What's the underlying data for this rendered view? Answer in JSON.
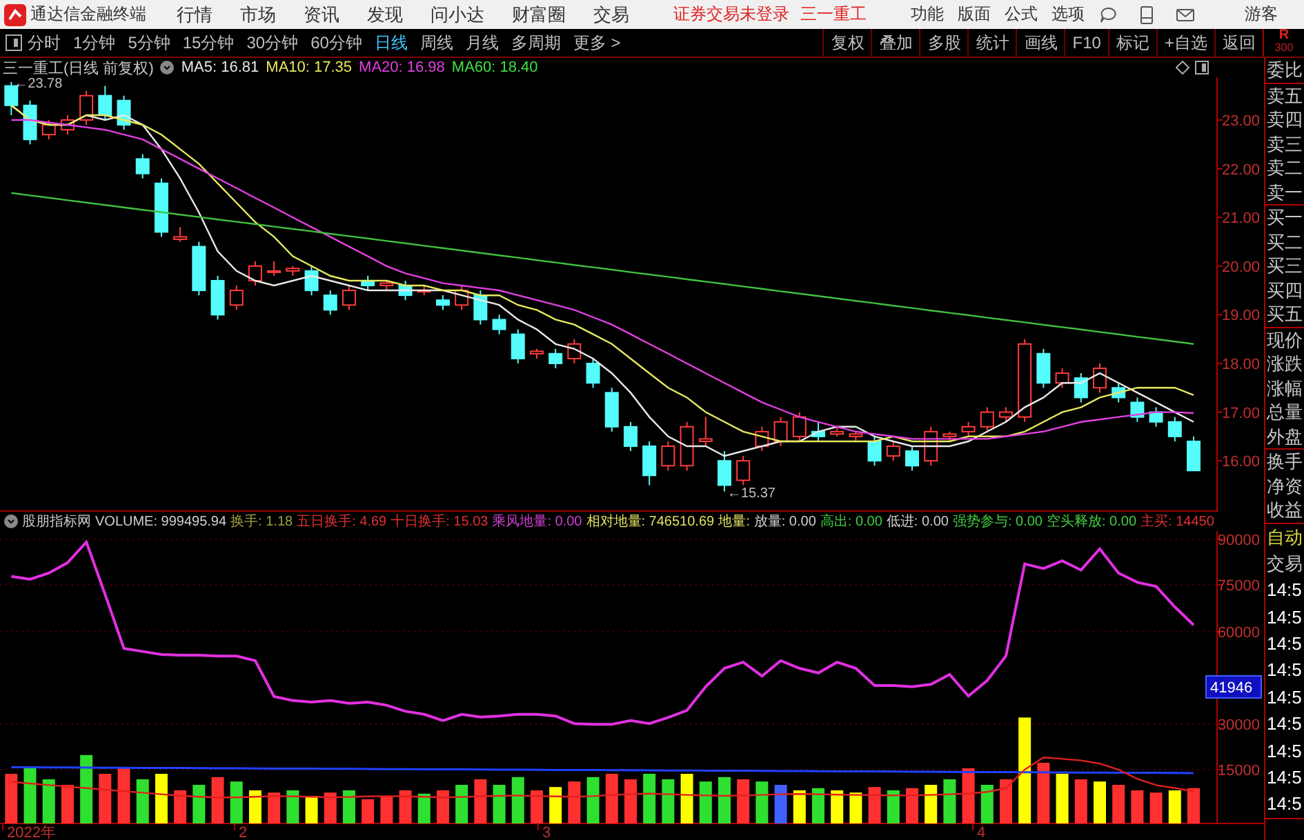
{
  "menu_bar": {
    "app_title": "通达信金融终端",
    "menus": [
      "行情",
      "市场",
      "资讯",
      "发现",
      "问小达",
      "财富圈",
      "交易"
    ],
    "notice": "证券交易未登录",
    "stock": "三一重工",
    "tools": [
      "功能",
      "版面",
      "公式",
      "选项"
    ],
    "user": "游客"
  },
  "toolbar": {
    "periods": [
      {
        "label": "分时",
        "selected": false
      },
      {
        "label": "1分钟",
        "selected": false
      },
      {
        "label": "5分钟",
        "selected": false
      },
      {
        "label": "15分钟",
        "selected": false
      },
      {
        "label": "30分钟",
        "selected": false
      },
      {
        "label": "60分钟",
        "selected": false
      },
      {
        "label": "日线",
        "selected": true
      },
      {
        "label": "周线",
        "selected": false
      },
      {
        "label": "月线",
        "selected": false
      },
      {
        "label": "多周期",
        "selected": false
      },
      {
        "label": "更多 >",
        "selected": false
      }
    ],
    "buttons": [
      "复权",
      "叠加",
      "多股",
      "统计",
      "画线",
      "F10",
      "标记",
      "+自选",
      "返回"
    ]
  },
  "sidebar": {
    "top_label": "R",
    "top_sub": "300",
    "groups": [
      [
        {
          "label": "委比",
          "kind": "label"
        }
      ],
      [
        {
          "label": "卖五",
          "kind": "label"
        },
        {
          "label": "卖四",
          "kind": "label"
        },
        {
          "label": "卖三",
          "kind": "label"
        },
        {
          "label": "卖二",
          "kind": "label"
        },
        {
          "label": "卖一",
          "kind": "label"
        }
      ],
      [
        {
          "label": "买一",
          "kind": "label"
        },
        {
          "label": "买二",
          "kind": "label"
        },
        {
          "label": "买三",
          "kind": "label"
        },
        {
          "label": "买四",
          "kind": "label"
        },
        {
          "label": "买五",
          "kind": "label"
        }
      ],
      [
        {
          "label": "现价",
          "kind": "label"
        },
        {
          "label": "涨跌",
          "kind": "label"
        },
        {
          "label": "涨幅",
          "kind": "label"
        },
        {
          "label": "总量",
          "kind": "label"
        },
        {
          "label": "外盘",
          "kind": "label"
        }
      ],
      [
        {
          "label": "换手",
          "kind": "label"
        },
        {
          "label": "净资",
          "kind": "label"
        },
        {
          "label": "收益",
          "kind": "label"
        }
      ],
      [
        {
          "label": "自动",
          "kind": "accent"
        },
        {
          "label": "交易",
          "kind": "label"
        },
        {
          "label": "14:5",
          "kind": "time"
        },
        {
          "label": "14:5",
          "kind": "time"
        },
        {
          "label": "14:5",
          "kind": "time"
        },
        {
          "label": "14:5",
          "kind": "time"
        },
        {
          "label": "14:5",
          "kind": "time"
        },
        {
          "label": "14:5",
          "kind": "time"
        },
        {
          "label": "14:5",
          "kind": "time"
        },
        {
          "label": "14:5",
          "kind": "time"
        },
        {
          "label": "14:5",
          "kind": "time"
        }
      ]
    ]
  },
  "price_panel": {
    "title": "三一重工(日线 前复权)",
    "indicators": [
      {
        "text": "MA5: 16.81",
        "color": "#e8e8e8"
      },
      {
        "text": "MA10: 17.35",
        "color": "#e8e860"
      },
      {
        "text": "MA20: 16.98",
        "color": "#e040e0"
      },
      {
        "text": "MA60: 18.40",
        "color": "#40e040"
      }
    ],
    "axis_labels": [
      "23.00",
      "22.00",
      "21.00",
      "20.00",
      "19.00",
      "18.00",
      "17.00",
      "16.00"
    ],
    "annotations": [
      "←23.78",
      "←15.37"
    ]
  },
  "indicator_panel": {
    "title": "股朋指标网",
    "items": [
      {
        "text": "VOLUME: 999495.94",
        "color": "#d0d0d0"
      },
      {
        "text": "换手: 1.18",
        "color": "#a0a040"
      },
      {
        "text": "五日换手: 4.69",
        "color": "#e03030"
      },
      {
        "text": "十日换手: 15.03",
        "color": "#e03030"
      },
      {
        "text": "乘风地量: 0.00",
        "color": "#d040d0"
      },
      {
        "text": "相对地量: 746510.69",
        "color": "#e0e060"
      },
      {
        "text": "地量:",
        "color": "#e0e060"
      },
      {
        "text": "放量: 0.00",
        "color": "#d0d0d0"
      },
      {
        "text": "高出: 0.00",
        "color": "#40d040"
      },
      {
        "text": "低进: 0.00",
        "color": "#d0d0d0"
      },
      {
        "text": "强势参与: 0.00",
        "color": "#40d040"
      },
      {
        "text": "空头释放: 0.00",
        "color": "#40d040"
      },
      {
        "text": "主买: 14450",
        "color": "#e03030"
      }
    ],
    "axis_labels": [
      "90000",
      "75000",
      "60000",
      "30000",
      "15000"
    ],
    "cursor_value": "41946",
    "date_labels": [
      "2022年",
      "2",
      "3",
      "4"
    ]
  }
}
